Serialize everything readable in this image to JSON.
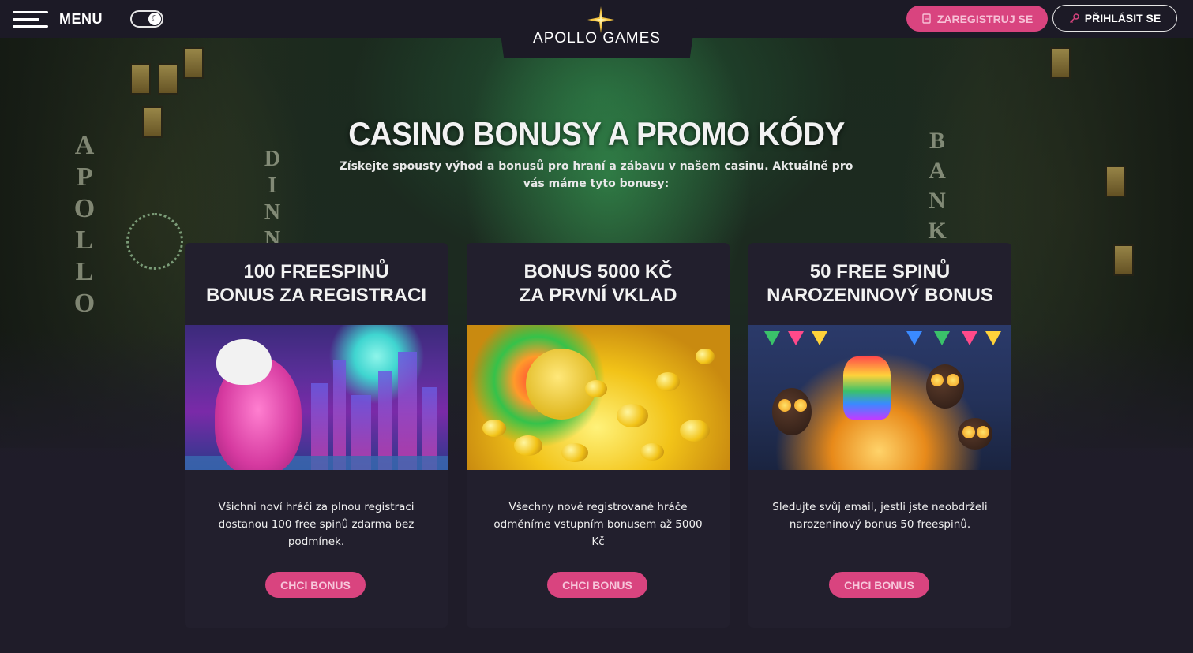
{
  "topbar": {
    "menu_label": "MENU",
    "logo_text": "APOLLO GAMES",
    "register_label": "ZAREGISTRUJ SE",
    "login_label": "PŘIHLÁSIT SE"
  },
  "hero": {
    "title": "CASINO BONUSY A PROMO KÓDY",
    "subtitle": "Získejte spousty výhod a bonusů pro hraní a zábavu v našem casinu. Aktuálně pro vás máme tyto bonusy:"
  },
  "cards": [
    {
      "title_line1": "100 FREESPINŮ",
      "title_line2": "BONUS ZA REGISTRACI",
      "description": "Všichni noví hráči za plnou registraci dostanou 100 free spinů zdarma bez podmínek.",
      "button_label": "CHCI BONUS"
    },
    {
      "title_line1": "BONUS 5000 KČ",
      "title_line2": "ZA PRVNÍ VKLAD",
      "description": "Všechny nově registrované hráče odměníme vstupním bonusem až 5000 Kč",
      "button_label": "CHCI BONUS"
    },
    {
      "title_line1": "50 FREE SPINŮ",
      "title_line2": "NAROZENINOVÝ BONUS",
      "description": "Sledujte svůj email, jestli jste neobdrželi narozeninový bonus 50 freespinů.",
      "button_label": "CHCI BONUS"
    }
  ],
  "colors": {
    "accent": "#d9447f",
    "background": "#1f1c29",
    "card": "#221f2d"
  },
  "icons": {
    "menu": "hamburger-icon",
    "theme": "moon-icon",
    "register": "document-icon",
    "login": "key-icon",
    "logo": "star-icon"
  }
}
